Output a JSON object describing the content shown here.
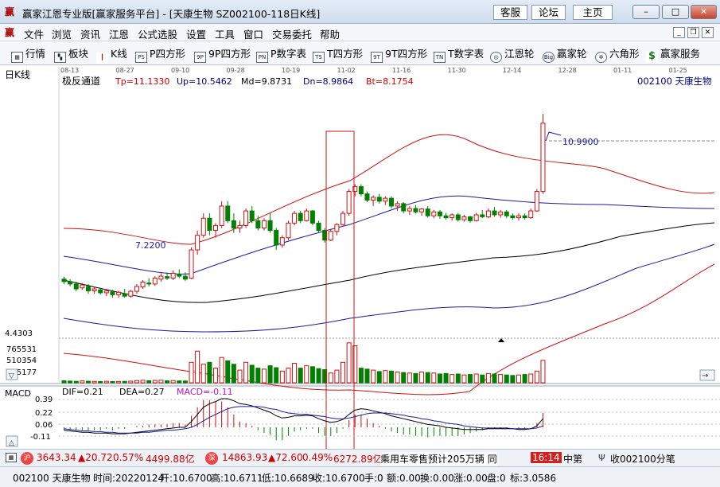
{
  "titlebar": {
    "title": "赢家江恩专业版[赢家服务平台] - [天康生物  SZ002100-118日K线]",
    "buttons": [
      "客服",
      "论坛",
      "主页"
    ]
  },
  "menu": [
    "文件",
    "浏览",
    "资讯",
    "江恩",
    "公式选股",
    "设置",
    "工具",
    "窗口",
    "交易委托",
    "帮助"
  ],
  "toolbar": [
    {
      "label": "行情",
      "icon": "grid-icon"
    },
    {
      "label": "板块",
      "icon": "blocks-icon"
    },
    {
      "label": "K线",
      "icon": "candlestick-icon"
    },
    {
      "label": "P四方形",
      "icon": "ps-icon",
      "code": "PS"
    },
    {
      "label": "9P四方形",
      "icon": "9ps-icon",
      "code": "9P"
    },
    {
      "label": "P数字表",
      "icon": "pn-icon",
      "code": "PN"
    },
    {
      "label": "T四方形",
      "icon": "ts-icon",
      "code": "TS"
    },
    {
      "label": "9T四方形",
      "icon": "9ts-icon",
      "code": "9T"
    },
    {
      "label": "T数字表",
      "icon": "tn-icon",
      "code": "TN"
    },
    {
      "label": "江恩轮",
      "icon": "gann-wheel-icon"
    },
    {
      "label": "赢家轮",
      "icon": "winner-wheel-icon",
      "code": "Big"
    },
    {
      "label": "六角形",
      "icon": "hexagon-icon"
    },
    {
      "label": "赢家服务",
      "icon": "dollar-icon",
      "code": "$"
    }
  ],
  "chart": {
    "period_label": "日K线",
    "indicator_name": "极反通道",
    "Tp": "Tp=11.1330",
    "Up": "Up=10.5462",
    "Md": "Md=9.8731",
    "Dn": "Dn=8.9864",
    "Bt": "Bt=8.1754",
    "stock_label": "002100  天康生物",
    "date_ticks": [
      "08-13",
      "08-27",
      "09-10",
      "09-28",
      "10-19",
      "11-02",
      "11-16",
      "11-30",
      "12-14",
      "12-28",
      "01-11",
      "01-25"
    ],
    "high_label": "10.9900",
    "low_label": "7.2200",
    "volume_max_label": "4.4303",
    "volume_ticks": [
      "765531",
      "510354",
      "255177"
    ],
    "macd_name": "MACD",
    "dif": "DIF=0.21",
    "dea": "DEA=0.27",
    "macd": "MACD=-0.11",
    "macd_ticks": [
      "0.39",
      "0.22",
      "0.06",
      "-0.11"
    ]
  },
  "chart_data": {
    "type": "candlestick",
    "price_range": [
      6.6,
      11.5
    ],
    "candles": [
      [
        7.6,
        7.65,
        7.5,
        7.55
      ],
      [
        7.55,
        7.6,
        7.45,
        7.5
      ],
      [
        7.5,
        7.55,
        7.35,
        7.4
      ],
      [
        7.42,
        7.52,
        7.38,
        7.48
      ],
      [
        7.45,
        7.5,
        7.3,
        7.36
      ],
      [
        7.36,
        7.45,
        7.3,
        7.4
      ],
      [
        7.38,
        7.42,
        7.28,
        7.32
      ],
      [
        7.32,
        7.4,
        7.25,
        7.36
      ],
      [
        7.34,
        7.38,
        7.22,
        7.28
      ],
      [
        7.28,
        7.36,
        7.22,
        7.33
      ],
      [
        7.3,
        7.4,
        7.22,
        7.25
      ],
      [
        7.25,
        7.38,
        7.22,
        7.35
      ],
      [
        7.35,
        7.5,
        7.3,
        7.45
      ],
      [
        7.44,
        7.58,
        7.4,
        7.54
      ],
      [
        7.52,
        7.62,
        7.45,
        7.5
      ],
      [
        7.5,
        7.66,
        7.46,
        7.62
      ],
      [
        7.6,
        7.72,
        7.55,
        7.66
      ],
      [
        7.65,
        7.74,
        7.58,
        7.62
      ],
      [
        7.62,
        7.78,
        7.58,
        7.72
      ],
      [
        7.7,
        7.8,
        7.62,
        7.66
      ],
      [
        7.66,
        7.74,
        7.56,
        7.6
      ],
      [
        7.62,
        8.25,
        7.6,
        8.2
      ],
      [
        8.2,
        8.6,
        8.1,
        8.5
      ],
      [
        8.5,
        8.95,
        8.45,
        8.85
      ],
      [
        8.85,
        8.95,
        8.5,
        8.6
      ],
      [
        8.6,
        8.75,
        8.45,
        8.7
      ],
      [
        8.7,
        9.2,
        8.65,
        9.1
      ],
      [
        9.1,
        9.2,
        8.75,
        8.8
      ],
      [
        8.8,
        8.95,
        8.55,
        8.65
      ],
      [
        8.65,
        8.8,
        8.55,
        8.7
      ],
      [
        8.7,
        9.05,
        8.65,
        9.0
      ],
      [
        9.0,
        9.1,
        8.75,
        8.8
      ],
      [
        8.8,
        8.9,
        8.6,
        8.65
      ],
      [
        8.65,
        8.85,
        8.6,
        8.8
      ],
      [
        8.8,
        8.95,
        8.55,
        8.6
      ],
      [
        8.6,
        8.65,
        8.2,
        8.3
      ],
      [
        8.3,
        8.5,
        8.25,
        8.45
      ],
      [
        8.45,
        8.8,
        8.4,
        8.75
      ],
      [
        8.75,
        9.0,
        8.7,
        8.95
      ],
      [
        8.95,
        9.0,
        8.75,
        8.8
      ],
      [
        8.8,
        9.05,
        8.78,
        9.0
      ],
      [
        9.0,
        9.02,
        8.7,
        8.75
      ],
      [
        8.75,
        8.8,
        8.55,
        8.6
      ],
      [
        8.6,
        8.65,
        8.35,
        8.4
      ],
      [
        8.4,
        8.62,
        8.38,
        8.58
      ],
      [
        8.58,
        8.75,
        8.5,
        8.72
      ],
      [
        8.72,
        9.0,
        8.7,
        8.95
      ],
      [
        8.95,
        9.45,
        8.9,
        9.4
      ],
      [
        9.4,
        9.55,
        9.3,
        9.5
      ],
      [
        9.5,
        9.55,
        9.3,
        9.35
      ],
      [
        9.35,
        9.4,
        9.18,
        9.22
      ],
      [
        9.22,
        9.32,
        9.1,
        9.28
      ],
      [
        9.28,
        9.35,
        9.15,
        9.2
      ],
      [
        9.2,
        9.3,
        9.12,
        9.26
      ],
      [
        9.26,
        9.3,
        9.05,
        9.1
      ],
      [
        9.1,
        9.2,
        9.0,
        9.15
      ],
      [
        9.15,
        9.18,
        8.95,
        9.0
      ],
      [
        9.0,
        9.1,
        8.92,
        9.05
      ],
      [
        9.05,
        9.12,
        8.95,
        8.98
      ],
      [
        8.98,
        9.06,
        8.9,
        9.04
      ],
      [
        9.04,
        9.1,
        8.86,
        8.9
      ],
      [
        8.9,
        9.02,
        8.85,
        8.98
      ],
      [
        8.98,
        9.02,
        8.84,
        8.9
      ],
      [
        8.9,
        8.96,
        8.82,
        8.86
      ],
      [
        8.86,
        8.95,
        8.8,
        8.92
      ],
      [
        8.92,
        8.96,
        8.78,
        8.82
      ],
      [
        8.82,
        8.92,
        8.78,
        8.88
      ],
      [
        8.88,
        8.9,
        8.76,
        8.8
      ],
      [
        8.8,
        8.96,
        8.78,
        8.92
      ],
      [
        8.92,
        9.02,
        8.85,
        8.88
      ],
      [
        8.88,
        9.05,
        8.85,
        9.0
      ],
      [
        9.0,
        9.08,
        8.88,
        8.92
      ],
      [
        8.92,
        9.02,
        8.86,
        8.98
      ],
      [
        8.98,
        9.02,
        8.85,
        8.9
      ],
      [
        8.9,
        8.95,
        8.82,
        8.86
      ],
      [
        8.86,
        8.95,
        8.8,
        8.9
      ],
      [
        8.9,
        8.95,
        8.82,
        8.86
      ],
      [
        8.86,
        9.05,
        8.84,
        9.0
      ],
      [
        9.0,
        9.45,
        8.98,
        9.4
      ],
      [
        9.4,
        10.99,
        9.35,
        10.8
      ]
    ],
    "volumes": [
      40000,
      35000,
      30000,
      38000,
      32000,
      28000,
      26000,
      30000,
      25000,
      27000,
      29000,
      33000,
      45000,
      50000,
      42000,
      48000,
      52000,
      40000,
      46000,
      38000,
      36000,
      420000,
      650000,
      380000,
      420000,
      300000,
      520000,
      450000,
      380000,
      260000,
      420000,
      360000,
      300000,
      280000,
      350000,
      310000,
      240000,
      300000,
      400000,
      300000,
      350000,
      330000,
      290000,
      270000,
      200000,
      260000,
      420000,
      820000,
      760000,
      300000,
      280000,
      260000,
      230000,
      250000,
      240000,
      220000,
      210000,
      200000,
      190000,
      220000,
      210000,
      200000,
      180000,
      190000,
      170000,
      180000,
      160000,
      170000,
      180000,
      160000,
      190000,
      180000,
      170000,
      160000,
      150000,
      160000,
      170000,
      180000,
      240000,
      460000
    ],
    "macd_dif": [
      -0.04,
      -0.05,
      -0.06,
      -0.07,
      -0.07,
      -0.08,
      -0.08,
      -0.08,
      -0.09,
      -0.09,
      -0.09,
      -0.08,
      -0.07,
      -0.06,
      -0.05,
      -0.04,
      -0.03,
      -0.02,
      -0.01,
      0.0,
      0.0,
      0.08,
      0.18,
      0.28,
      0.33,
      0.36,
      0.4,
      0.4,
      0.37,
      0.33,
      0.32,
      0.3,
      0.27,
      0.24,
      0.21,
      0.16,
      0.13,
      0.14,
      0.16,
      0.16,
      0.17,
      0.16,
      0.12,
      0.09,
      0.07,
      0.08,
      0.11,
      0.18,
      0.24,
      0.26,
      0.25,
      0.23,
      0.21,
      0.19,
      0.16,
      0.14,
      0.12,
      0.1,
      0.08,
      0.06,
      0.04,
      0.03,
      0.02,
      0.0,
      -0.01,
      -0.02,
      -0.03,
      -0.03,
      -0.03,
      -0.03,
      -0.02,
      -0.02,
      -0.02,
      -0.02,
      -0.02,
      -0.03,
      -0.03,
      -0.02,
      0.02,
      0.12
    ],
    "macd_dea": [
      -0.02,
      -0.03,
      -0.04,
      -0.05,
      -0.05,
      -0.06,
      -0.06,
      -0.07,
      -0.07,
      -0.08,
      -0.08,
      -0.08,
      -0.08,
      -0.07,
      -0.07,
      -0.06,
      -0.05,
      -0.04,
      -0.04,
      -0.03,
      -0.02,
      0.0,
      0.04,
      0.09,
      0.14,
      0.18,
      0.22,
      0.26,
      0.28,
      0.29,
      0.29,
      0.29,
      0.29,
      0.28,
      0.26,
      0.25,
      0.22,
      0.2,
      0.19,
      0.18,
      0.18,
      0.17,
      0.16,
      0.15,
      0.13,
      0.12,
      0.12,
      0.13,
      0.15,
      0.17,
      0.19,
      0.2,
      0.2,
      0.2,
      0.19,
      0.18,
      0.17,
      0.15,
      0.14,
      0.12,
      0.11,
      0.09,
      0.08,
      0.06,
      0.05,
      0.04,
      0.02,
      0.01,
      0.0,
      -0.01,
      -0.01,
      -0.01,
      -0.01,
      -0.01,
      -0.02,
      -0.02,
      -0.02,
      -0.02,
      -0.01,
      0.02
    ]
  },
  "status": {
    "sh_index": "3643.34",
    "sh_change": "▲20.72",
    "sh_pct": "0.57%",
    "sh_amount": "4499.88亿",
    "sz_index": "14863.93",
    "sz_change": "▲72.60",
    "sz_pct": "0.49%",
    "sz_amount": "6272.89亿",
    "news": "乘用车零售预计205万辆 同",
    "time": "16:14",
    "org": "中第",
    "receive": "收002100分笔"
  },
  "info": {
    "code_name": "002100 天康生物",
    "time": "时间:20220124",
    "open": "开:10.6700",
    "high": "高:10.6711",
    "low": "低:10.6689",
    "close": "收:10.6700",
    "hand": "手:0",
    "amount": "额:0.00",
    "turnover": "换:0.00",
    "rise": "涨:0.00",
    "market": "盘:0",
    "mark": "标:3.0586"
  }
}
